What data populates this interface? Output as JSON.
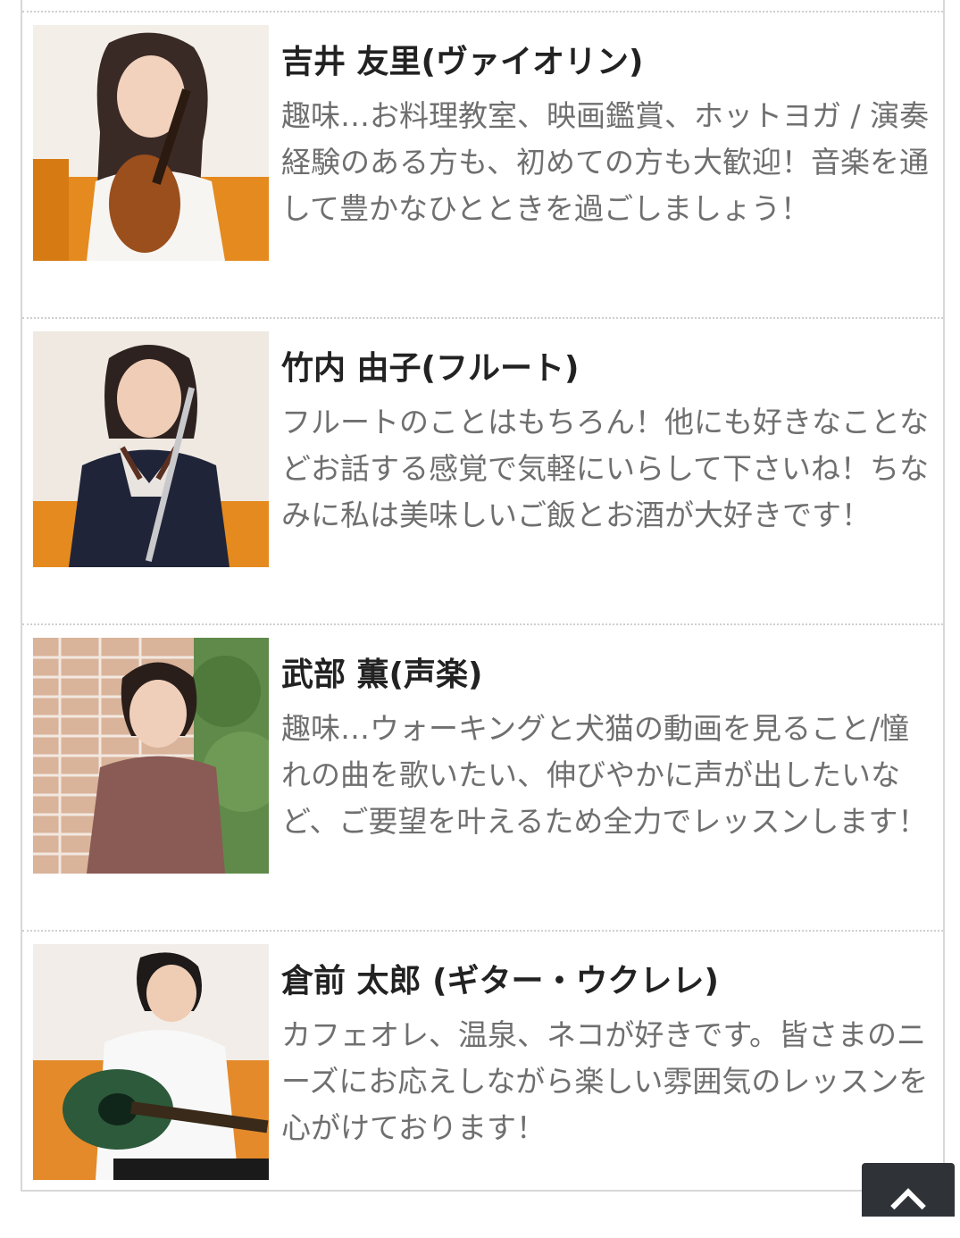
{
  "teachers": [
    {
      "name": "吉井 友里(ヴァイオリン)",
      "description": "趣味…お料理教室、映画鑑賞、ホットヨガ / 演奏経験のある方も、初めての方も大歓迎！音楽を通して豊かなひとときを過ごしましょう！",
      "photo_alt": "violin-teacher-photo"
    },
    {
      "name": "竹内 由子(フルート)",
      "description": "フルートのことはもちろん！他にも好きなことなどお話する感覚で気軽にいらして下さいね！ちなみに私は美味しいご飯とお酒が大好きです！",
      "photo_alt": "flute-teacher-photo"
    },
    {
      "name": "武部 薫(声楽)",
      "description": "趣味…ウォーキングと犬猫の動画を見ること/憧れの曲を歌いたい、伸びやかに声が出したいなど、ご要望を叶えるため全力でレッスンします！",
      "photo_alt": "vocal-teacher-photo"
    },
    {
      "name": "倉前 太郎 (ギター・ウクレレ)",
      "description": "カフェオレ、温泉、ネコが好きです。皆さまのニーズにお応えしながら楽しい雰囲気のレッスンを心がけております！",
      "photo_alt": "guitar-teacher-photo"
    }
  ],
  "scroll_top_button": {
    "icon": "chevron-up-icon"
  },
  "colors": {
    "name_text": "#222222",
    "description_text": "#6f6f6f",
    "border": "#d7d7d7",
    "scroll_button_bg": "#2f3338"
  }
}
